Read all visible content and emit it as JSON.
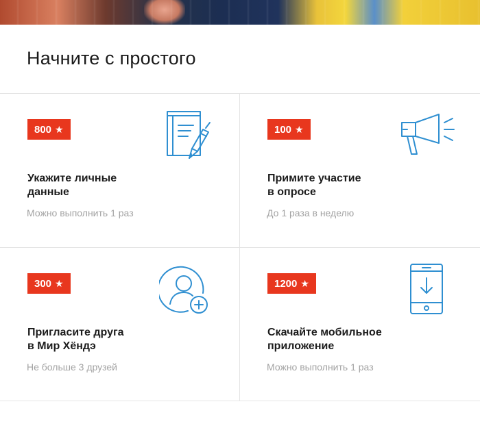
{
  "section": {
    "title": "Начните с простого"
  },
  "tasks": [
    {
      "points": "800",
      "title_line1": "Укажите личные",
      "title_line2": "данные",
      "note": "Можно выполнить 1 раз",
      "icon": "notebook-pen-icon"
    },
    {
      "points": "100",
      "title_line1": "Примите участие",
      "title_line2": "в опросе",
      "note": "До 1 раза в неделю",
      "icon": "megaphone-icon"
    },
    {
      "points": "300",
      "title_line1": "Пригласите друга",
      "title_line2": "в Мир Хёндэ",
      "note": "Не больше 3 друзей",
      "icon": "add-user-icon"
    },
    {
      "points": "1200",
      "title_line1": "Скачайте мобильное",
      "title_line2": "приложение",
      "note": "Можно выполнить 1 раз",
      "icon": "phone-download-icon"
    }
  ],
  "colors": {
    "badge": "#e8371e",
    "icon": "#2f8fd1",
    "muted": "#a3a3a3"
  }
}
